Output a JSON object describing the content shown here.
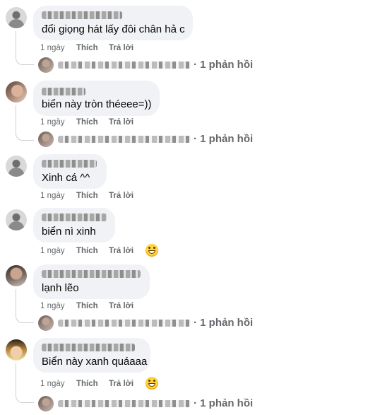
{
  "comments": [
    {
      "text": "đổi giọng hát lấy đôi chân hả c",
      "actions": {
        "time": "1 ngày",
        "like": "Thích",
        "reply": "Trả lời"
      },
      "replies": "· 1 phản hồi"
    },
    {
      "text": "biển này tròn théeee=))",
      "actions": {
        "time": "1 ngày",
        "like": "Thích",
        "reply": "Trả lời"
      },
      "replies": "· 1 phản hồi"
    },
    {
      "text": "Xinh cá ^^",
      "actions": {
        "time": "1 ngày",
        "like": "Thích",
        "reply": "Trả lời"
      }
    },
    {
      "text": "biển nì xinh",
      "actions": {
        "time": "1 ngày",
        "like": "Thích",
        "reply": "Trả lời"
      },
      "reaction_icon": "grinning-emoji-icon"
    },
    {
      "text": "lạnh lẽo",
      "actions": {
        "time": "1 ngày",
        "like": "Thích",
        "reply": "Trả lời"
      },
      "replies": "· 1 phản hồi"
    },
    {
      "text": "Biển này xanh quáaaa",
      "actions": {
        "time": "1 ngày",
        "like": "Thích",
        "reply": "Trả lời"
      },
      "reaction_icon": "grinning-emoji-icon",
      "replies": "· 1 phản hồi"
    }
  ],
  "colors": {
    "bubble": "#f0f2f5",
    "meta_text": "#65676b",
    "text": "#050505"
  }
}
